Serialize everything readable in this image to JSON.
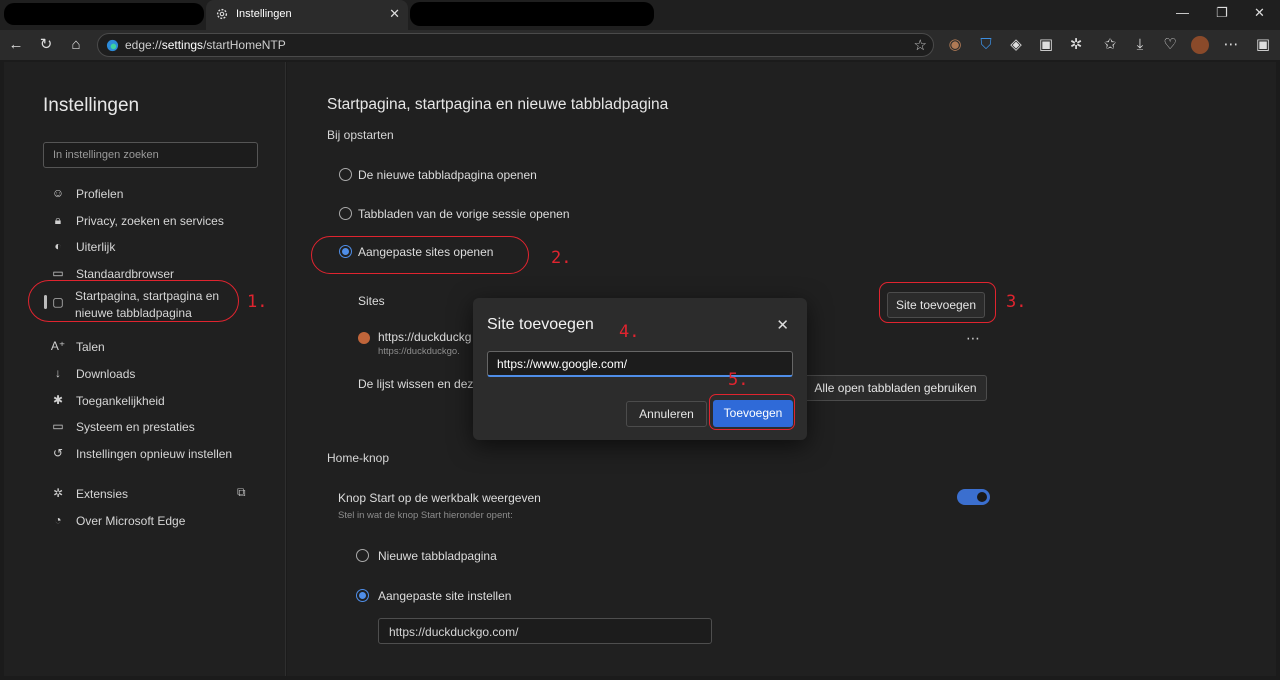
{
  "browser": {
    "tab_title": "Instellingen",
    "url_scheme": "edge://",
    "url_host": "settings",
    "url_path": "/startHomeNTP"
  },
  "sidebar": {
    "title": "Instellingen",
    "search_placeholder": "In instellingen zoeken",
    "items": [
      {
        "label": "Profielen",
        "icon": "profile-icon"
      },
      {
        "label": "Privacy, zoeken en services",
        "icon": "lock-icon"
      },
      {
        "label": "Uiterlijk",
        "icon": "palette-icon"
      },
      {
        "label": "Standaardbrowser",
        "icon": "browser-icon"
      },
      {
        "label": "Startpagina, startpagina en",
        "label2": "nieuwe tabbladpagina",
        "icon": "home-page-icon"
      },
      {
        "label": "Talen",
        "icon": "languages-icon"
      },
      {
        "label": "Downloads",
        "icon": "download-icon"
      },
      {
        "label": "Toegankelijkheid",
        "icon": "accessibility-icon"
      },
      {
        "label": "Systeem en prestaties",
        "icon": "laptop-icon"
      },
      {
        "label": "Instellingen opnieuw instellen",
        "icon": "reset-icon"
      },
      {
        "label": "Extensies",
        "icon": "puzzle-icon"
      },
      {
        "label": "Over Microsoft Edge",
        "icon": "edge-icon"
      }
    ]
  },
  "main": {
    "title": "Startpagina, startpagina en nieuwe tabbladpagina",
    "startup_heading": "Bij opstarten",
    "startup_options": [
      "De nieuwe tabbladpagina openen",
      "Tabbladen van de vorige sessie openen",
      "Aangepaste sites openen"
    ],
    "sites_label": "Sites",
    "add_site_button": "Site toevoegen",
    "site_entry_title": "https://duckduckg",
    "site_entry_url": "https://duckduckgo.",
    "clear_list_text": "De lijst wissen en deze",
    "use_all_tabs_button": "Alle open tabbladen gebruiken",
    "home_heading": "Home-knop",
    "home_toggle_label": "Knop Start op de werkbalk weergeven",
    "home_toggle_sub": "Stel in wat de knop Start hieronder opent:",
    "home_options": [
      "Nieuwe tabbladpagina",
      "Aangepaste site instellen"
    ],
    "home_site_value": "https://duckduckgo.com/"
  },
  "dialog": {
    "title": "Site toevoegen",
    "input_value": "https://www.google.com/",
    "cancel_label": "Annuleren",
    "add_label": "Toevoegen"
  },
  "annotations": [
    "1.",
    "2.",
    "3.",
    "4.",
    "5."
  ]
}
